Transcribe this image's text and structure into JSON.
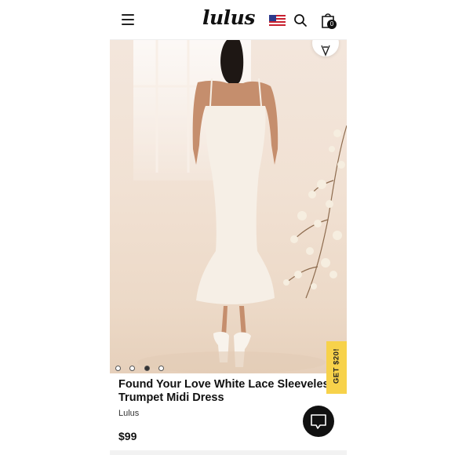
{
  "header": {
    "logo": "lulus",
    "menu_icon": "hamburger-menu-icon",
    "flag_icon": "us-flag-icon",
    "search_icon": "search-icon",
    "bag_icon": "shopping-bag-icon",
    "bag_count": "0"
  },
  "gallery": {
    "total_images": 4,
    "active_index": 3,
    "pin_icon": "pinterest-icon"
  },
  "promo": {
    "label": "GET $20!"
  },
  "product": {
    "title_line1": "Found Your Love White Lace Sleeveless",
    "title_line2": "Trumpet Midi Dress",
    "brand": "Lulus",
    "price": "$99"
  },
  "chat": {
    "icon": "chat-icon"
  },
  "colors": {
    "promo": "#f7d24a",
    "text": "#111111",
    "chat_bg": "#111111"
  }
}
